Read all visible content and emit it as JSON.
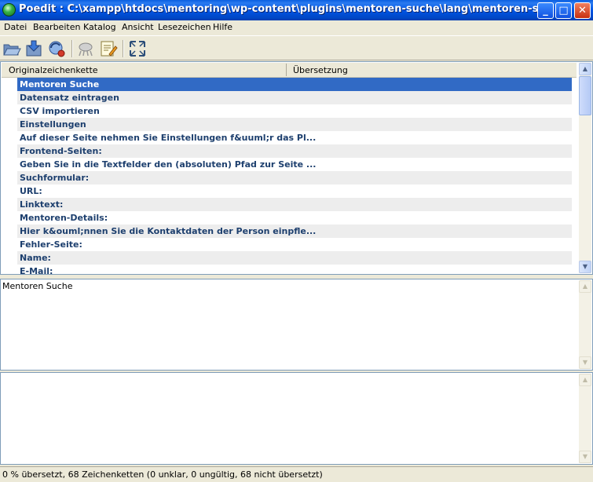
{
  "window": {
    "title": "Poedit : C:\\xampp\\htdocs\\mentoring\\wp-content\\plugins\\mentoren-suche\\lang\\mentoren-suche.pot (ge...",
    "minimize": "_",
    "maximize": "□",
    "close": "✕"
  },
  "menu": [
    "Datei",
    "Bearbeiten",
    "Katalog",
    "Ansicht",
    "Lesezeichen",
    "Hilfe"
  ],
  "toolbar": {
    "buttons": [
      "open-icon",
      "save-icon",
      "update-icon",
      "validate-icon",
      "comment-icon",
      "fullscreen-icon"
    ]
  },
  "list": {
    "headers": {
      "source": "Originalzeichenkette",
      "translation": "Übersetzung"
    },
    "rows": [
      "Mentoren Suche",
      "Datensatz eintragen",
      "CSV importieren",
      "Einstellungen",
      "Auf dieser Seite nehmen Sie Einstellungen f&uuml;r das  Pl...",
      "Frontend-Seiten:",
      "Geben Sie in die Textfelder den (absoluten) Pfad zur Seite ...",
      "Suchformular:",
      "URL:",
      "Linktext:",
      "Mentoren-Details:",
      "Hier k&ouml;nnen Sie die Kontaktdaten der Person einpfle...",
      "Fehler-Seite:",
      "Name:",
      "E-Mail:"
    ],
    "selected_index": 0
  },
  "source_panel": {
    "text": "Mentoren Suche"
  },
  "status": {
    "text": "0 % übersetzt, 68 Zeichenketten (0 unklar, 0 ungültig, 68 nicht übersetzt)"
  },
  "colors": {
    "selection": "#316ac5",
    "row_text": "#1d3f6e",
    "titlebar": "#0055e5"
  }
}
